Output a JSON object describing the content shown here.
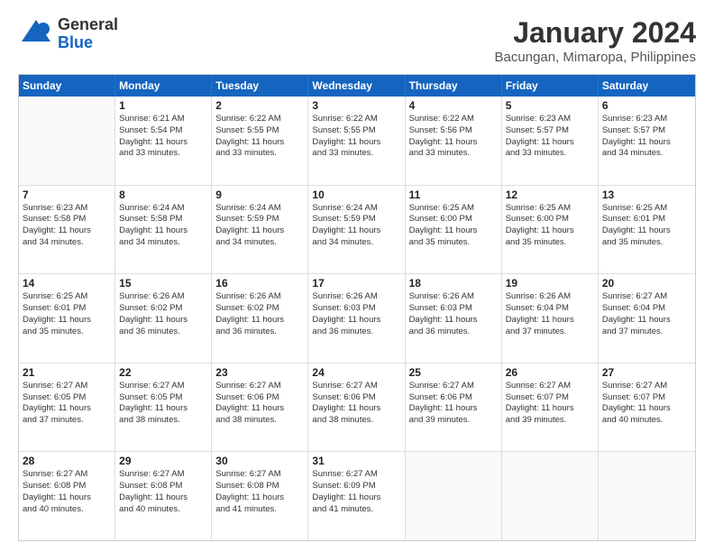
{
  "header": {
    "logo_general": "General",
    "logo_blue": "Blue",
    "title": "January 2024",
    "subtitle": "Bacungan, Mimaropa, Philippines"
  },
  "calendar": {
    "days": [
      "Sunday",
      "Monday",
      "Tuesday",
      "Wednesday",
      "Thursday",
      "Friday",
      "Saturday"
    ],
    "weeks": [
      [
        {
          "num": "",
          "lines": []
        },
        {
          "num": "1",
          "lines": [
            "Sunrise: 6:21 AM",
            "Sunset: 5:54 PM",
            "Daylight: 11 hours",
            "and 33 minutes."
          ]
        },
        {
          "num": "2",
          "lines": [
            "Sunrise: 6:22 AM",
            "Sunset: 5:55 PM",
            "Daylight: 11 hours",
            "and 33 minutes."
          ]
        },
        {
          "num": "3",
          "lines": [
            "Sunrise: 6:22 AM",
            "Sunset: 5:55 PM",
            "Daylight: 11 hours",
            "and 33 minutes."
          ]
        },
        {
          "num": "4",
          "lines": [
            "Sunrise: 6:22 AM",
            "Sunset: 5:56 PM",
            "Daylight: 11 hours",
            "and 33 minutes."
          ]
        },
        {
          "num": "5",
          "lines": [
            "Sunrise: 6:23 AM",
            "Sunset: 5:57 PM",
            "Daylight: 11 hours",
            "and 33 minutes."
          ]
        },
        {
          "num": "6",
          "lines": [
            "Sunrise: 6:23 AM",
            "Sunset: 5:57 PM",
            "Daylight: 11 hours",
            "and 34 minutes."
          ]
        }
      ],
      [
        {
          "num": "7",
          "lines": [
            "Sunrise: 6:23 AM",
            "Sunset: 5:58 PM",
            "Daylight: 11 hours",
            "and 34 minutes."
          ]
        },
        {
          "num": "8",
          "lines": [
            "Sunrise: 6:24 AM",
            "Sunset: 5:58 PM",
            "Daylight: 11 hours",
            "and 34 minutes."
          ]
        },
        {
          "num": "9",
          "lines": [
            "Sunrise: 6:24 AM",
            "Sunset: 5:59 PM",
            "Daylight: 11 hours",
            "and 34 minutes."
          ]
        },
        {
          "num": "10",
          "lines": [
            "Sunrise: 6:24 AM",
            "Sunset: 5:59 PM",
            "Daylight: 11 hours",
            "and 34 minutes."
          ]
        },
        {
          "num": "11",
          "lines": [
            "Sunrise: 6:25 AM",
            "Sunset: 6:00 PM",
            "Daylight: 11 hours",
            "and 35 minutes."
          ]
        },
        {
          "num": "12",
          "lines": [
            "Sunrise: 6:25 AM",
            "Sunset: 6:00 PM",
            "Daylight: 11 hours",
            "and 35 minutes."
          ]
        },
        {
          "num": "13",
          "lines": [
            "Sunrise: 6:25 AM",
            "Sunset: 6:01 PM",
            "Daylight: 11 hours",
            "and 35 minutes."
          ]
        }
      ],
      [
        {
          "num": "14",
          "lines": [
            "Sunrise: 6:25 AM",
            "Sunset: 6:01 PM",
            "Daylight: 11 hours",
            "and 35 minutes."
          ]
        },
        {
          "num": "15",
          "lines": [
            "Sunrise: 6:26 AM",
            "Sunset: 6:02 PM",
            "Daylight: 11 hours",
            "and 36 minutes."
          ]
        },
        {
          "num": "16",
          "lines": [
            "Sunrise: 6:26 AM",
            "Sunset: 6:02 PM",
            "Daylight: 11 hours",
            "and 36 minutes."
          ]
        },
        {
          "num": "17",
          "lines": [
            "Sunrise: 6:26 AM",
            "Sunset: 6:03 PM",
            "Daylight: 11 hours",
            "and 36 minutes."
          ]
        },
        {
          "num": "18",
          "lines": [
            "Sunrise: 6:26 AM",
            "Sunset: 6:03 PM",
            "Daylight: 11 hours",
            "and 36 minutes."
          ]
        },
        {
          "num": "19",
          "lines": [
            "Sunrise: 6:26 AM",
            "Sunset: 6:04 PM",
            "Daylight: 11 hours",
            "and 37 minutes."
          ]
        },
        {
          "num": "20",
          "lines": [
            "Sunrise: 6:27 AM",
            "Sunset: 6:04 PM",
            "Daylight: 11 hours",
            "and 37 minutes."
          ]
        }
      ],
      [
        {
          "num": "21",
          "lines": [
            "Sunrise: 6:27 AM",
            "Sunset: 6:05 PM",
            "Daylight: 11 hours",
            "and 37 minutes."
          ]
        },
        {
          "num": "22",
          "lines": [
            "Sunrise: 6:27 AM",
            "Sunset: 6:05 PM",
            "Daylight: 11 hours",
            "and 38 minutes."
          ]
        },
        {
          "num": "23",
          "lines": [
            "Sunrise: 6:27 AM",
            "Sunset: 6:06 PM",
            "Daylight: 11 hours",
            "and 38 minutes."
          ]
        },
        {
          "num": "24",
          "lines": [
            "Sunrise: 6:27 AM",
            "Sunset: 6:06 PM",
            "Daylight: 11 hours",
            "and 38 minutes."
          ]
        },
        {
          "num": "25",
          "lines": [
            "Sunrise: 6:27 AM",
            "Sunset: 6:06 PM",
            "Daylight: 11 hours",
            "and 39 minutes."
          ]
        },
        {
          "num": "26",
          "lines": [
            "Sunrise: 6:27 AM",
            "Sunset: 6:07 PM",
            "Daylight: 11 hours",
            "and 39 minutes."
          ]
        },
        {
          "num": "27",
          "lines": [
            "Sunrise: 6:27 AM",
            "Sunset: 6:07 PM",
            "Daylight: 11 hours",
            "and 40 minutes."
          ]
        }
      ],
      [
        {
          "num": "28",
          "lines": [
            "Sunrise: 6:27 AM",
            "Sunset: 6:08 PM",
            "Daylight: 11 hours",
            "and 40 minutes."
          ]
        },
        {
          "num": "29",
          "lines": [
            "Sunrise: 6:27 AM",
            "Sunset: 6:08 PM",
            "Daylight: 11 hours",
            "and 40 minutes."
          ]
        },
        {
          "num": "30",
          "lines": [
            "Sunrise: 6:27 AM",
            "Sunset: 6:08 PM",
            "Daylight: 11 hours",
            "and 41 minutes."
          ]
        },
        {
          "num": "31",
          "lines": [
            "Sunrise: 6:27 AM",
            "Sunset: 6:09 PM",
            "Daylight: 11 hours",
            "and 41 minutes."
          ]
        },
        {
          "num": "",
          "lines": []
        },
        {
          "num": "",
          "lines": []
        },
        {
          "num": "",
          "lines": []
        }
      ]
    ]
  }
}
